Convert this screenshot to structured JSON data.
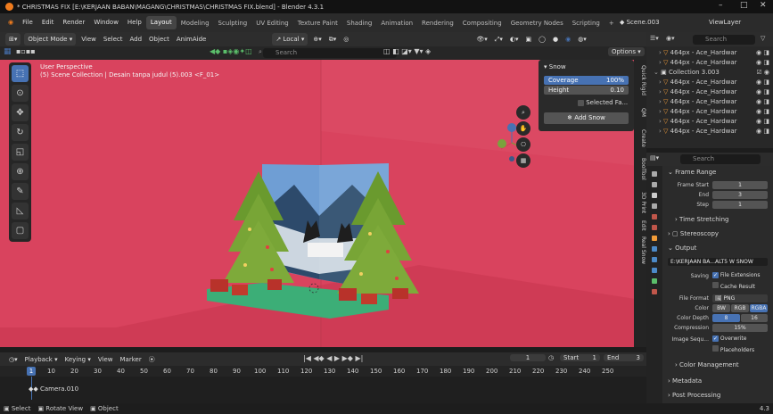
{
  "window": {
    "title": "* CHRISTMAS FIX [E:\\KERJAAN BABAN\\MAGANG\\CHRISTMAS\\CHRISTMAS FIX.blend] - Blender 4.3.1"
  },
  "menu": {
    "items": [
      "File",
      "Edit",
      "Render",
      "Window",
      "Help"
    ]
  },
  "workspaces": {
    "active": "Layout",
    "items": [
      "Layout",
      "Modeling",
      "Sculpting",
      "UV Editing",
      "Texture Paint",
      "Shading",
      "Animation",
      "Rendering",
      "Compositing",
      "Geometry Nodes",
      "Scripting"
    ]
  },
  "scene": {
    "name": "Scene.003",
    "view_layer": "ViewLayer"
  },
  "viewport_header": {
    "mode": "Object Mode",
    "items": [
      "View",
      "Select",
      "Add",
      "Object",
      "AnimAide"
    ],
    "transform": "Local",
    "options": "Options"
  },
  "viewport": {
    "perspective": "User Perspective",
    "collection_info": "(5) Scene Collection | Desain tanpa judul (5).003 <F_01>"
  },
  "snow_panel": {
    "title": "Snow",
    "coverage_label": "Coverage",
    "coverage_value": "100%",
    "height_label": "Height",
    "height_value": "0.10",
    "selected_label": "Selected Fa...",
    "add_snow": "Add Snow"
  },
  "side_tabs": [
    "Quick Rigid",
    "QM",
    "Create",
    "BoolTool",
    "3D Print",
    "Edit",
    "Real Snow"
  ],
  "search": {
    "placeholder": "Search"
  },
  "outliner": {
    "rows": [
      {
        "label": "464px - Ace_Hardwar"
      },
      {
        "label": "464px - Ace_Hardwar"
      },
      {
        "label": "Collection 3.003"
      },
      {
        "label": "464px - Ace_Hardwar"
      },
      {
        "label": "464px - Ace_Hardwar"
      },
      {
        "label": "464px - Ace_Hardwar"
      },
      {
        "label": "464px - Ace_Hardwar"
      },
      {
        "label": "464px - Ace_Hardwar"
      },
      {
        "label": "464px - Ace_Hardwar"
      }
    ]
  },
  "properties": {
    "frame_range": "Frame Range",
    "frame_start_label": "Frame Start",
    "frame_start": "1",
    "end_label": "End",
    "end": "3",
    "step_label": "Step",
    "step": "1",
    "time_stretching": "Time Stretching",
    "stereoscopy": "Stereoscopy",
    "output": "Output",
    "output_path": "E:\\KERJAAN BA...ALT5 W SNOW",
    "saving_label": "Saving",
    "file_extensions": "File Extensions",
    "cache_result": "Cache Result",
    "file_format_label": "File Format",
    "file_format": "PNG",
    "color_label": "Color",
    "color_bw": "BW",
    "color_rgb": "RGB",
    "color_rgba": "RGBA",
    "color_depth_label": "Color Depth",
    "depth_8": "8",
    "depth_16": "16",
    "compression_label": "Compression",
    "compression": "15%",
    "image_seq_label": "Image Sequ...",
    "overwrite": "Overwrite",
    "placeholders": "Placeholders",
    "color_management": "Color Management",
    "metadata": "Metadata",
    "post_processing": "Post Processing"
  },
  "timeline": {
    "playback": "Playback",
    "keying": "Keying",
    "view": "View",
    "marker": "Marker",
    "current_frame": "1",
    "start_label": "Start",
    "start": "1",
    "end_label": "End",
    "end": "3",
    "ticks": [
      "10",
      "20",
      "30",
      "40",
      "50",
      "60",
      "70",
      "80",
      "90",
      "100",
      "110",
      "120",
      "130",
      "140",
      "150",
      "160",
      "170",
      "180",
      "190",
      "200",
      "210",
      "220",
      "230",
      "240",
      "250"
    ],
    "camera": "Camera.010"
  },
  "status": {
    "select": "Select",
    "rotate": "Rotate View",
    "object": "Object",
    "version": "4.3"
  },
  "colors": {
    "viewport_bg": "#d9435e",
    "accent": "#4772b3"
  }
}
